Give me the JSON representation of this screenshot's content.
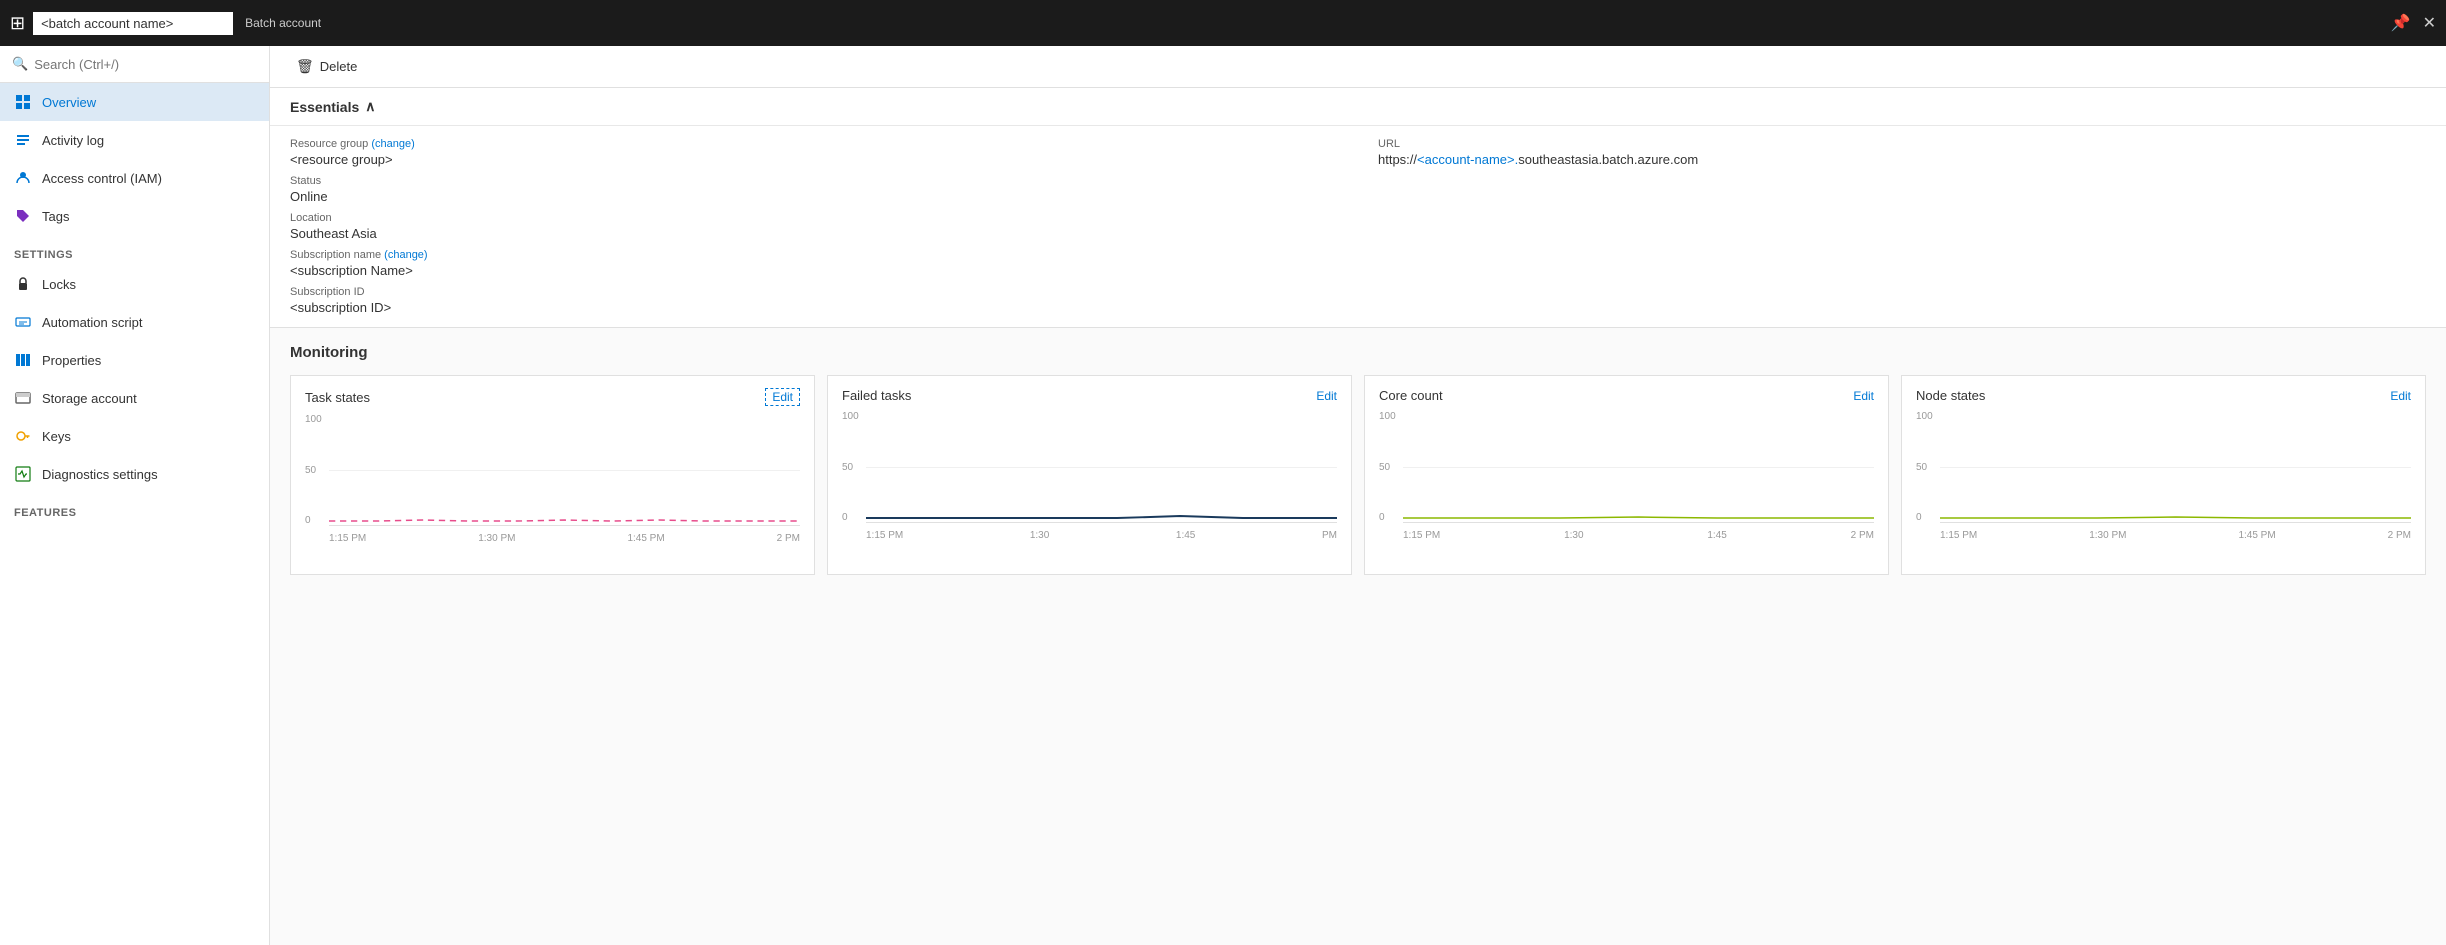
{
  "topbar": {
    "input_value": "<batch account name>",
    "subtitle": "Batch account",
    "pin_icon": "📌",
    "close_icon": "✕"
  },
  "sidebar": {
    "search_placeholder": "Search (Ctrl+/)",
    "nav_items": [
      {
        "id": "overview",
        "label": "Overview",
        "icon": "overview",
        "active": true
      },
      {
        "id": "activity-log",
        "label": "Activity log",
        "icon": "activity"
      },
      {
        "id": "access-control",
        "label": "Access control (IAM)",
        "icon": "iam"
      },
      {
        "id": "tags",
        "label": "Tags",
        "icon": "tags"
      }
    ],
    "settings_label": "SETTINGS",
    "settings_items": [
      {
        "id": "locks",
        "label": "Locks",
        "icon": "locks"
      },
      {
        "id": "automation-script",
        "label": "Automation script",
        "icon": "automation"
      },
      {
        "id": "properties",
        "label": "Properties",
        "icon": "properties"
      },
      {
        "id": "storage-account",
        "label": "Storage account",
        "icon": "storage"
      },
      {
        "id": "keys",
        "label": "Keys",
        "icon": "keys"
      },
      {
        "id": "diagnostics",
        "label": "Diagnostics settings",
        "icon": "diagnostics"
      }
    ],
    "features_label": "FEATURES"
  },
  "toolbar": {
    "delete_label": "Delete"
  },
  "essentials": {
    "header": "Essentials",
    "resource_group_label": "Resource group",
    "resource_group_change": "(change)",
    "resource_group_value": "<resource group>",
    "status_label": "Status",
    "status_value": "Online",
    "location_label": "Location",
    "location_value": "Southeast Asia",
    "subscription_name_label": "Subscription name",
    "subscription_name_change": "(change)",
    "subscription_name_value": "<subscription Name>",
    "subscription_id_label": "Subscription ID",
    "subscription_id_value": "<subscription ID>",
    "url_label": "URL",
    "url_prefix": "https://",
    "url_account": "<account-name>.",
    "url_suffix": "southeastasia.batch.azure.com"
  },
  "monitoring": {
    "title": "Monitoring",
    "cards": [
      {
        "id": "task-states",
        "title": "Task states",
        "edit_label": "Edit",
        "edit_style": "dashed",
        "y_labels": [
          "100",
          "50",
          "0"
        ],
        "x_labels": [
          "1:15 PM",
          "1:30 PM",
          "1:45 PM",
          "2 PM"
        ],
        "line_color": "#e74c8b",
        "line_style": "dashed"
      },
      {
        "id": "failed-tasks",
        "title": "Failed tasks",
        "edit_label": "Edit",
        "edit_style": "plain",
        "y_labels": [
          "100",
          "50",
          "0"
        ],
        "x_labels": [
          "1:15 PM",
          "1:30",
          "1:45",
          "PM"
        ],
        "line_color": "#1a3a5c",
        "line_style": "solid"
      },
      {
        "id": "core-count",
        "title": "Core count",
        "edit_label": "Edit",
        "edit_style": "plain",
        "y_labels": [
          "100",
          "50",
          "0"
        ],
        "x_labels": [
          "1:15 PM",
          "1:30",
          "1:45",
          "2 PM"
        ],
        "line_color": "#8cb800",
        "line_style": "solid"
      },
      {
        "id": "node-states",
        "title": "Node states",
        "edit_label": "Edit",
        "edit_style": "plain",
        "y_labels": [
          "100",
          "50",
          "0"
        ],
        "x_labels": [
          "1:15 PM",
          "1:30 PM",
          "1:45 PM",
          "2 PM"
        ],
        "line_color": "#8cb800",
        "line_style": "solid"
      }
    ]
  }
}
